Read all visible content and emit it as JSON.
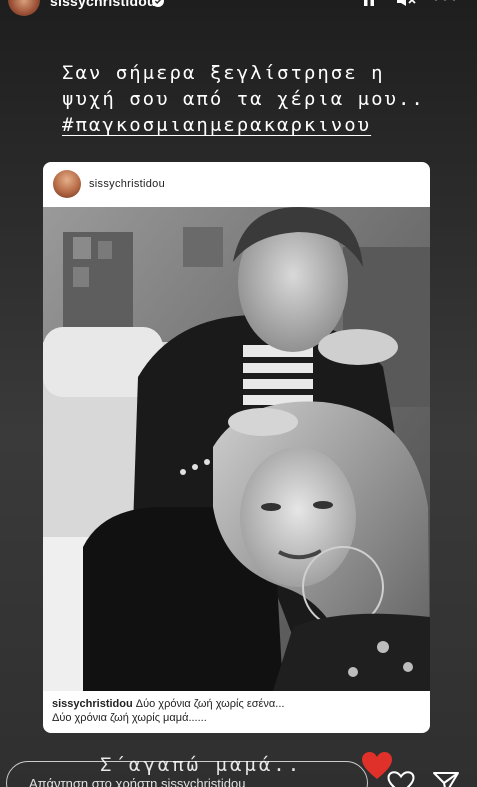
{
  "header": {
    "username": "sissychristidou",
    "verified": true,
    "icons": [
      "pause-icon",
      "mute-icon",
      "more-icon"
    ]
  },
  "caption": {
    "line1": "Σαν σήμερα ξεγλίστρησε η",
    "line2": "ψυχή σου από τα χέρια μου..",
    "hashtag": "#παγκοσμιαημερακαρκινου"
  },
  "post": {
    "username": "sissychristidou",
    "caption_line1": "Δύο χρόνια ζωή χωρίς εσένα...",
    "caption_line2": "Δύο χρόνια ζωή χωρίς μαμά......"
  },
  "bottom_text": "Σ΄αγαπώ μαμά..",
  "sticker": "red-heart",
  "reply": {
    "placeholder": "Απάντηση στο χρήστη sissychristidou"
  },
  "colors": {
    "background": "#2b2b2b",
    "heart_sticker": "#e0302a",
    "card_bg": "#ffffff"
  }
}
